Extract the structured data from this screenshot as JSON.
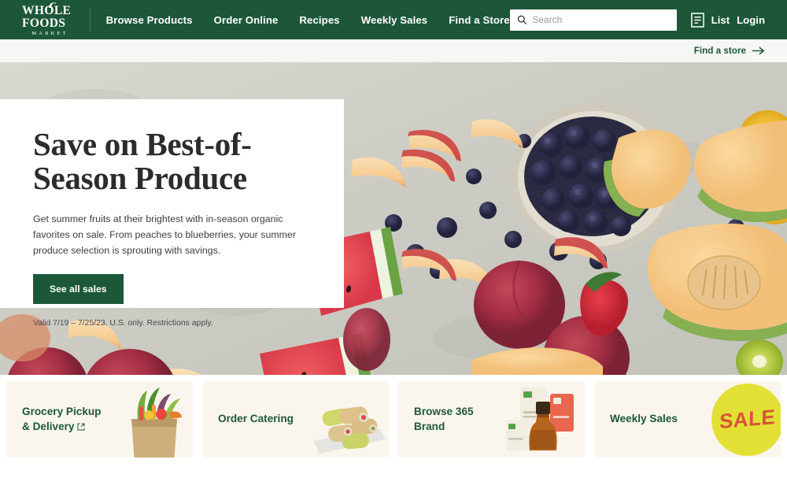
{
  "brand": {
    "name_line1": "WHOLE FOODS",
    "name_line2": "MARKET",
    "green": "#1d5739",
    "cream": "#faf6ed",
    "badge_yellow": "#e3e035",
    "badge_red": "#d9533a"
  },
  "nav": {
    "links": [
      {
        "label": "Browse Products"
      },
      {
        "label": "Order Online"
      },
      {
        "label": "Recipes"
      },
      {
        "label": "Weekly Sales"
      },
      {
        "label": "Find a Store"
      }
    ],
    "search": {
      "placeholder": "Search",
      "value": "",
      "icon": "search-icon"
    },
    "list_label": "List",
    "list_icon": "list-icon",
    "login_label": "Login"
  },
  "store_strip": {
    "label": "Find a store",
    "icon": "arrow-right-icon"
  },
  "hero": {
    "title": "Save on Best-of-Season Produce",
    "body": "Get summer fruits at their brightest with in-season organic favorites on sale. From peaches to blueberries, your summer produce selection is sprouting with savings.",
    "cta_label": "See all sales",
    "fine_print": "Valid 7/19 – 7/25/23. U.S. only. Restrictions apply.",
    "image_alt": "Assorted summer fruits on stone surface"
  },
  "cards": [
    {
      "label_line1": "Grocery Pickup",
      "label_line2": "& Delivery",
      "external": true,
      "art": "grocery-bag"
    },
    {
      "label_line1": "Order Catering",
      "label_line2": "",
      "external": false,
      "art": "catering-wraps"
    },
    {
      "label_line1": "Browse 365",
      "label_line2": "Brand",
      "external": false,
      "art": "brand-products"
    },
    {
      "label_line1": "Weekly Sales",
      "label_line2": "",
      "external": false,
      "art": "sale-badge",
      "badge_text": "SALE"
    }
  ]
}
